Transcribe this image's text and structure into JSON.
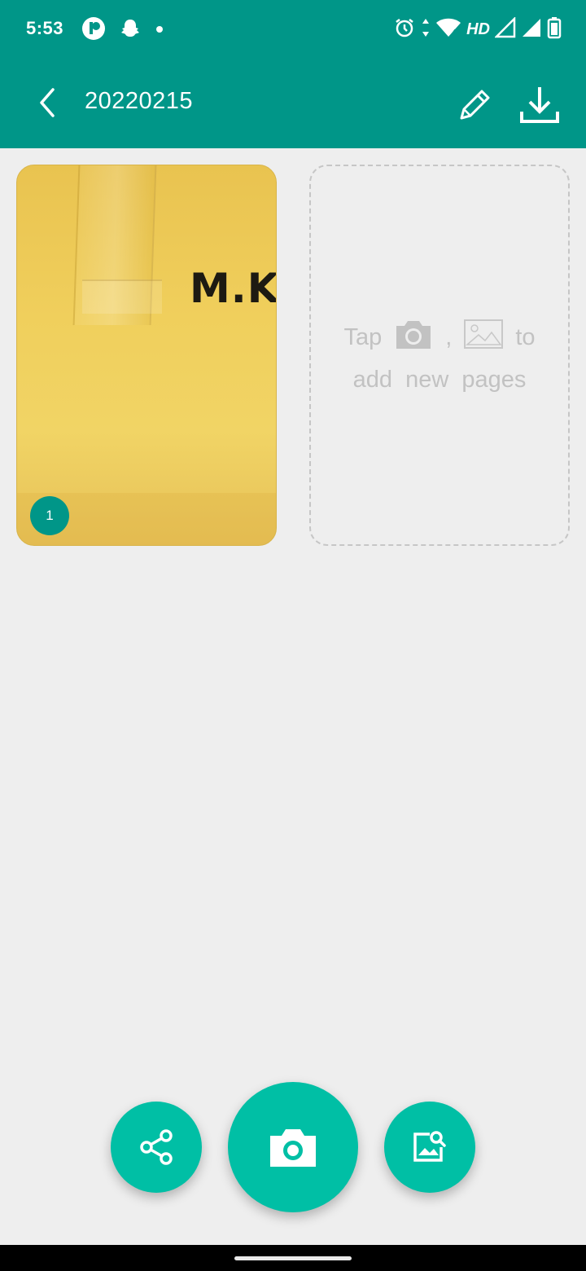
{
  "status_bar": {
    "time": "5:53",
    "network_label": "HD",
    "icons": [
      "app-notification-icon",
      "snapchat-icon",
      "dot-icon",
      "alarm-icon",
      "data-arrows-icon",
      "wifi-icon",
      "signal-icon",
      "signal-icon",
      "battery-icon"
    ]
  },
  "app_bar": {
    "title": "20220215",
    "back_icon": "chevron-left-icon",
    "edit_icon": "pencil-icon",
    "download_icon": "download-icon"
  },
  "pages": [
    {
      "number": "1",
      "preview_text": "M.K"
    }
  ],
  "add_page_hint": {
    "line1_before": "Tap",
    "line1_separator": ",",
    "line1_after": "to",
    "line2": "add new pages"
  },
  "fabs": {
    "share_icon": "share-icon",
    "camera_icon": "camera-icon",
    "gallery_icon": "image-search-icon"
  },
  "colors": {
    "primary": "#009688",
    "accent": "#00bfa5",
    "background": "#eeeeee",
    "hint_text": "#c2c2c2"
  }
}
